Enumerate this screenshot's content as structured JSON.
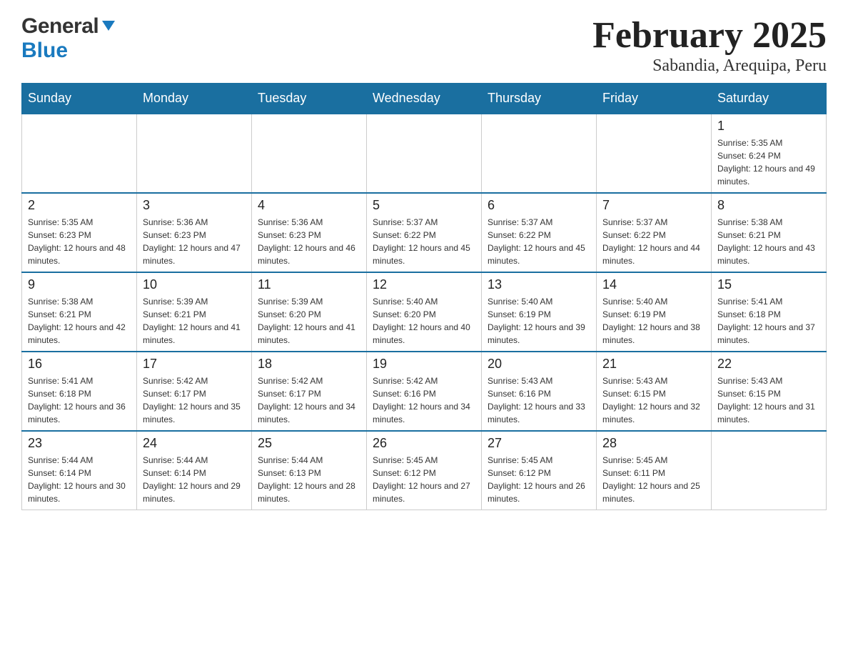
{
  "header": {
    "logo_general": "General",
    "logo_blue": "Blue",
    "title": "February 2025",
    "subtitle": "Sabandia, Arequipa, Peru"
  },
  "days_of_week": [
    "Sunday",
    "Monday",
    "Tuesday",
    "Wednesday",
    "Thursday",
    "Friday",
    "Saturday"
  ],
  "weeks": [
    [
      {
        "day": "",
        "info": ""
      },
      {
        "day": "",
        "info": ""
      },
      {
        "day": "",
        "info": ""
      },
      {
        "day": "",
        "info": ""
      },
      {
        "day": "",
        "info": ""
      },
      {
        "day": "",
        "info": ""
      },
      {
        "day": "1",
        "info": "Sunrise: 5:35 AM\nSunset: 6:24 PM\nDaylight: 12 hours and 49 minutes."
      }
    ],
    [
      {
        "day": "2",
        "info": "Sunrise: 5:35 AM\nSunset: 6:23 PM\nDaylight: 12 hours and 48 minutes."
      },
      {
        "day": "3",
        "info": "Sunrise: 5:36 AM\nSunset: 6:23 PM\nDaylight: 12 hours and 47 minutes."
      },
      {
        "day": "4",
        "info": "Sunrise: 5:36 AM\nSunset: 6:23 PM\nDaylight: 12 hours and 46 minutes."
      },
      {
        "day": "5",
        "info": "Sunrise: 5:37 AM\nSunset: 6:22 PM\nDaylight: 12 hours and 45 minutes."
      },
      {
        "day": "6",
        "info": "Sunrise: 5:37 AM\nSunset: 6:22 PM\nDaylight: 12 hours and 45 minutes."
      },
      {
        "day": "7",
        "info": "Sunrise: 5:37 AM\nSunset: 6:22 PM\nDaylight: 12 hours and 44 minutes."
      },
      {
        "day": "8",
        "info": "Sunrise: 5:38 AM\nSunset: 6:21 PM\nDaylight: 12 hours and 43 minutes."
      }
    ],
    [
      {
        "day": "9",
        "info": "Sunrise: 5:38 AM\nSunset: 6:21 PM\nDaylight: 12 hours and 42 minutes."
      },
      {
        "day": "10",
        "info": "Sunrise: 5:39 AM\nSunset: 6:21 PM\nDaylight: 12 hours and 41 minutes."
      },
      {
        "day": "11",
        "info": "Sunrise: 5:39 AM\nSunset: 6:20 PM\nDaylight: 12 hours and 41 minutes."
      },
      {
        "day": "12",
        "info": "Sunrise: 5:40 AM\nSunset: 6:20 PM\nDaylight: 12 hours and 40 minutes."
      },
      {
        "day": "13",
        "info": "Sunrise: 5:40 AM\nSunset: 6:19 PM\nDaylight: 12 hours and 39 minutes."
      },
      {
        "day": "14",
        "info": "Sunrise: 5:40 AM\nSunset: 6:19 PM\nDaylight: 12 hours and 38 minutes."
      },
      {
        "day": "15",
        "info": "Sunrise: 5:41 AM\nSunset: 6:18 PM\nDaylight: 12 hours and 37 minutes."
      }
    ],
    [
      {
        "day": "16",
        "info": "Sunrise: 5:41 AM\nSunset: 6:18 PM\nDaylight: 12 hours and 36 minutes."
      },
      {
        "day": "17",
        "info": "Sunrise: 5:42 AM\nSunset: 6:17 PM\nDaylight: 12 hours and 35 minutes."
      },
      {
        "day": "18",
        "info": "Sunrise: 5:42 AM\nSunset: 6:17 PM\nDaylight: 12 hours and 34 minutes."
      },
      {
        "day": "19",
        "info": "Sunrise: 5:42 AM\nSunset: 6:16 PM\nDaylight: 12 hours and 34 minutes."
      },
      {
        "day": "20",
        "info": "Sunrise: 5:43 AM\nSunset: 6:16 PM\nDaylight: 12 hours and 33 minutes."
      },
      {
        "day": "21",
        "info": "Sunrise: 5:43 AM\nSunset: 6:15 PM\nDaylight: 12 hours and 32 minutes."
      },
      {
        "day": "22",
        "info": "Sunrise: 5:43 AM\nSunset: 6:15 PM\nDaylight: 12 hours and 31 minutes."
      }
    ],
    [
      {
        "day": "23",
        "info": "Sunrise: 5:44 AM\nSunset: 6:14 PM\nDaylight: 12 hours and 30 minutes."
      },
      {
        "day": "24",
        "info": "Sunrise: 5:44 AM\nSunset: 6:14 PM\nDaylight: 12 hours and 29 minutes."
      },
      {
        "day": "25",
        "info": "Sunrise: 5:44 AM\nSunset: 6:13 PM\nDaylight: 12 hours and 28 minutes."
      },
      {
        "day": "26",
        "info": "Sunrise: 5:45 AM\nSunset: 6:12 PM\nDaylight: 12 hours and 27 minutes."
      },
      {
        "day": "27",
        "info": "Sunrise: 5:45 AM\nSunset: 6:12 PM\nDaylight: 12 hours and 26 minutes."
      },
      {
        "day": "28",
        "info": "Sunrise: 5:45 AM\nSunset: 6:11 PM\nDaylight: 12 hours and 25 minutes."
      },
      {
        "day": "",
        "info": ""
      }
    ]
  ]
}
